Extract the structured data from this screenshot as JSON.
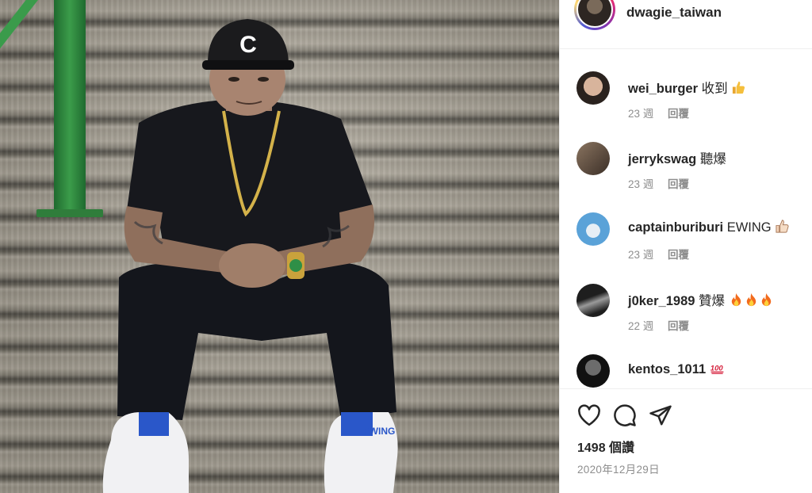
{
  "post": {
    "author": "dwagie_taiwan",
    "likes_label": "1498 個讚",
    "date": "2020年12月29日",
    "cap_text": "EWING",
    "photo_alt": "post-photo"
  },
  "comments": [
    {
      "user": "wei_burger",
      "text": "收到",
      "emoji": "thumbs-up",
      "age": "23 週",
      "reply": "回覆",
      "avatar_colors": [
        "#d8b49c",
        "#2a221e"
      ]
    },
    {
      "user": "jerrykswag",
      "text": "聽爆",
      "emoji": "",
      "age": "23 週",
      "reply": "回覆",
      "avatar_colors": [
        "#8a7460",
        "#3b2f27"
      ]
    },
    {
      "user": "captainburiburi",
      "text": "EWING",
      "emoji": "thumbs-up-outline",
      "age": "23 週",
      "reply": "回覆",
      "avatar_colors": [
        "#5aa2d8",
        "#e6eef5"
      ]
    },
    {
      "user": "j0ker_1989",
      "text": "贊爆",
      "emoji": "fire-x3",
      "age": "22 週",
      "reply": "回覆",
      "avatar_colors": [
        "#9a9a9a",
        "#1e1e1e"
      ]
    },
    {
      "user": "kentos_1011",
      "text": "",
      "emoji": "hundred-points",
      "age": "",
      "reply": "",
      "avatar_colors": [
        "#6c6c6c",
        "#111111"
      ]
    }
  ],
  "icons": {
    "like": "heart-icon",
    "comment": "comment-icon",
    "share": "send-icon"
  },
  "colors": {
    "text": "#262626",
    "muted": "#8e8e8e",
    "divider": "#efefef",
    "railing_green": "#2f7d3b",
    "hundred_red": "#d61f3b"
  }
}
